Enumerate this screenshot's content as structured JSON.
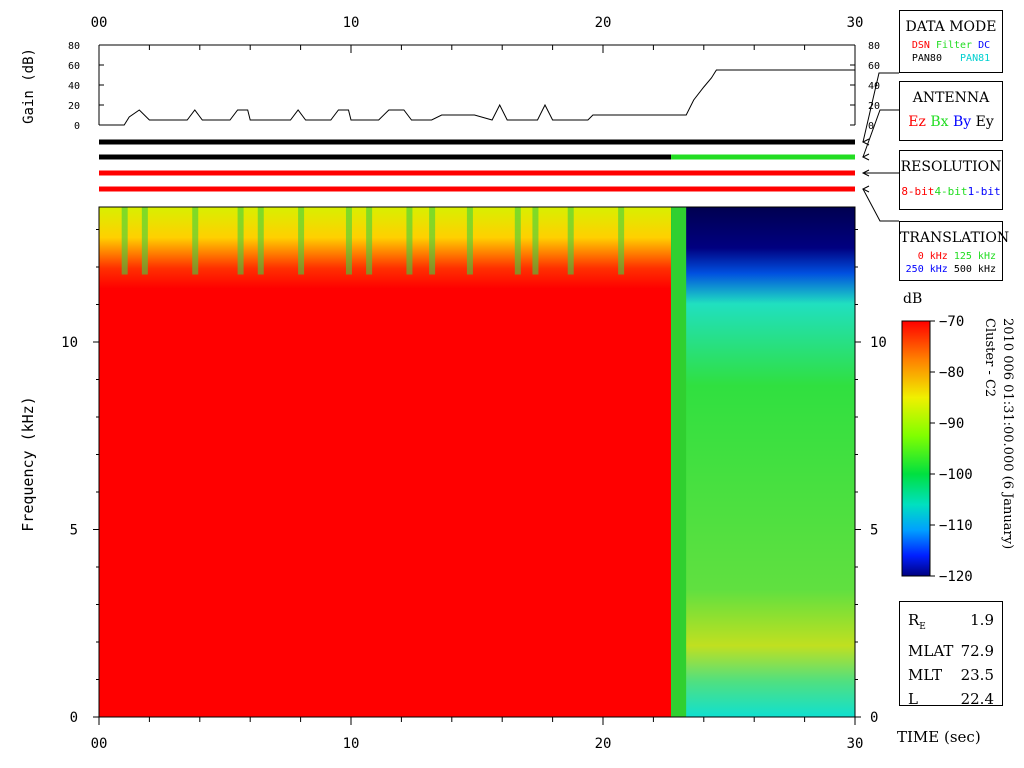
{
  "chart_data": [
    {
      "type": "line",
      "panel": "gain",
      "ylabel": "Gain (dB)",
      "yticks": [
        0,
        20,
        40,
        60,
        80
      ],
      "xticks": [
        "00",
        "10",
        "20",
        "30"
      ],
      "xlim": [
        0,
        30
      ],
      "ylim": [
        0,
        80
      ],
      "x": [
        0.0,
        1.0,
        1.2,
        1.6,
        2.0,
        3.5,
        3.8,
        4.1,
        5.2,
        5.5,
        5.9,
        6.0,
        7.6,
        7.9,
        8.2,
        9.2,
        9.5,
        9.9,
        10.0,
        11.1,
        11.5,
        12.1,
        12.4,
        13.2,
        13.6,
        14.9,
        15.6,
        15.9,
        16.2,
        17.4,
        17.7,
        18.0,
        19.4,
        19.6,
        23.3,
        23.6,
        24.0,
        24.3,
        24.5,
        30.0
      ],
      "y": [
        0,
        0,
        8,
        15,
        5,
        5,
        15,
        5,
        5,
        15,
        15,
        5,
        5,
        15,
        5,
        5,
        15,
        15,
        5,
        5,
        15,
        15,
        5,
        5,
        10,
        10,
        5,
        20,
        5,
        5,
        20,
        5,
        5,
        10,
        10,
        25,
        38,
        47,
        55,
        55
      ]
    },
    {
      "type": "heatmap",
      "panel": "spectrogram",
      "ylabel": "Frequency (kHz)",
      "xlabel": "TIME (sec)",
      "xticks": [
        "00",
        "10",
        "20",
        "30"
      ],
      "yticks": [
        0,
        5,
        10
      ],
      "xlim": [
        0,
        30
      ],
      "ylim": [
        0,
        13.6
      ],
      "colorbar": {
        "title": "dB",
        "min": -120,
        "max": -70,
        "ticks": [
          -70,
          -80,
          -90,
          -100,
          -110,
          -120
        ]
      },
      "regions": [
        {
          "x0": 0,
          "x1": 22.7,
          "level_low": -70,
          "level_top": -85,
          "top_boundary_khz": 11.2
        },
        {
          "x0": 22.7,
          "x1": 30,
          "level_low": -92,
          "level_top": -120,
          "top_boundary_khz": 11.2
        }
      ],
      "caption": "2010 006 01:31:00.000 (6 January)\nCluster - C2"
    }
  ],
  "indicators": {
    "colors": {
      "black": "#000000",
      "green": "#22dd22",
      "red": "#ff0000",
      "blue": "#0000ff",
      "cyan": "#00e0e0"
    },
    "bars": [
      {
        "name": "data-mode",
        "segments": [
          {
            "x0": 0,
            "x1": 30,
            "color": "#000000"
          }
        ]
      },
      {
        "name": "antenna",
        "segments": [
          {
            "x0": 0,
            "x1": 22.7,
            "color": "#000000"
          },
          {
            "x0": 22.7,
            "x1": 30,
            "color": "#22dd22"
          }
        ]
      },
      {
        "name": "resolution",
        "segments": [
          {
            "x0": 0,
            "x1": 30,
            "color": "#ff0000"
          }
        ]
      },
      {
        "name": "translation",
        "segments": [
          {
            "x0": 0,
            "x1": 30,
            "color": "#ff0000"
          }
        ]
      }
    ]
  },
  "legend": {
    "data_mode": {
      "title": "DATA MODE",
      "dsn": "DSN",
      "filter": "Filter",
      "dc": "DC",
      "pan80": "PAN80",
      "pan81": "PAN81"
    },
    "antenna": {
      "title": "ANTENNA",
      "ez": "Ez",
      "bx": "Bx",
      "by": "By",
      "ey": "Ey"
    },
    "resolution": {
      "title": "RESOLUTION",
      "b8": "8-bit",
      "b4": "4-bit",
      "b1": "1-bit"
    },
    "translation": {
      "title": "TRANSLATION",
      "k0": "0 kHz",
      "k125": "125 kHz",
      "k250": "250 kHz",
      "k500": "500 kHz"
    }
  },
  "orbit": [
    {
      "label": "R",
      "sub": "E",
      "value": "1.9"
    },
    {
      "label": "MLAT",
      "sub": "",
      "value": "72.9"
    },
    {
      "label": "MLT",
      "sub": "",
      "value": "23.5"
    },
    {
      "label": "L",
      "sub": "",
      "value": "22.4"
    }
  ]
}
